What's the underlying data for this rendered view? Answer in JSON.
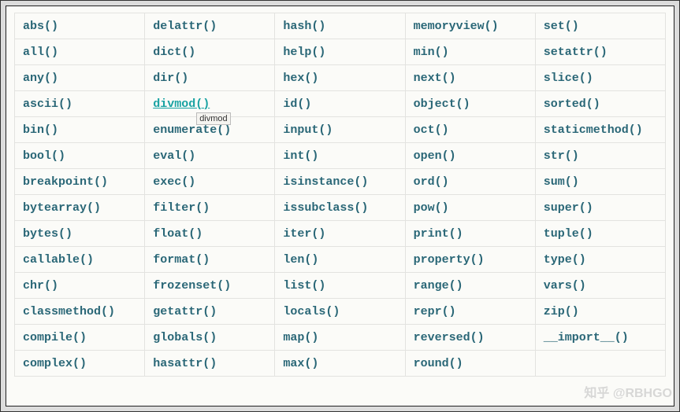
{
  "columns": 5,
  "hovered": {
    "row": 3,
    "col": 1,
    "tooltip": "divmod"
  },
  "watermark": "知乎 @RBHGO",
  "rows": [
    [
      "abs()",
      "delattr()",
      "hash()",
      "memoryview()",
      "set()"
    ],
    [
      "all()",
      "dict()",
      "help()",
      "min()",
      "setattr()"
    ],
    [
      "any()",
      "dir()",
      "hex()",
      "next()",
      "slice()"
    ],
    [
      "ascii()",
      "divmod()",
      "id()",
      "object()",
      "sorted()"
    ],
    [
      "bin()",
      "enumerate()",
      "input()",
      "oct()",
      "staticmethod()"
    ],
    [
      "bool()",
      "eval()",
      "int()",
      "open()",
      "str()"
    ],
    [
      "breakpoint()",
      "exec()",
      "isinstance()",
      "ord()",
      "sum()"
    ],
    [
      "bytearray()",
      "filter()",
      "issubclass()",
      "pow()",
      "super()"
    ],
    [
      "bytes()",
      "float()",
      "iter()",
      "print()",
      "tuple()"
    ],
    [
      "callable()",
      "format()",
      "len()",
      "property()",
      "type()"
    ],
    [
      "chr()",
      "frozenset()",
      "list()",
      "range()",
      "vars()"
    ],
    [
      "classmethod()",
      "getattr()",
      "locals()",
      "repr()",
      "zip()"
    ],
    [
      "compile()",
      "globals()",
      "map()",
      "reversed()",
      "__import__()"
    ],
    [
      "complex()",
      "hasattr()",
      "max()",
      "round()",
      ""
    ]
  ]
}
